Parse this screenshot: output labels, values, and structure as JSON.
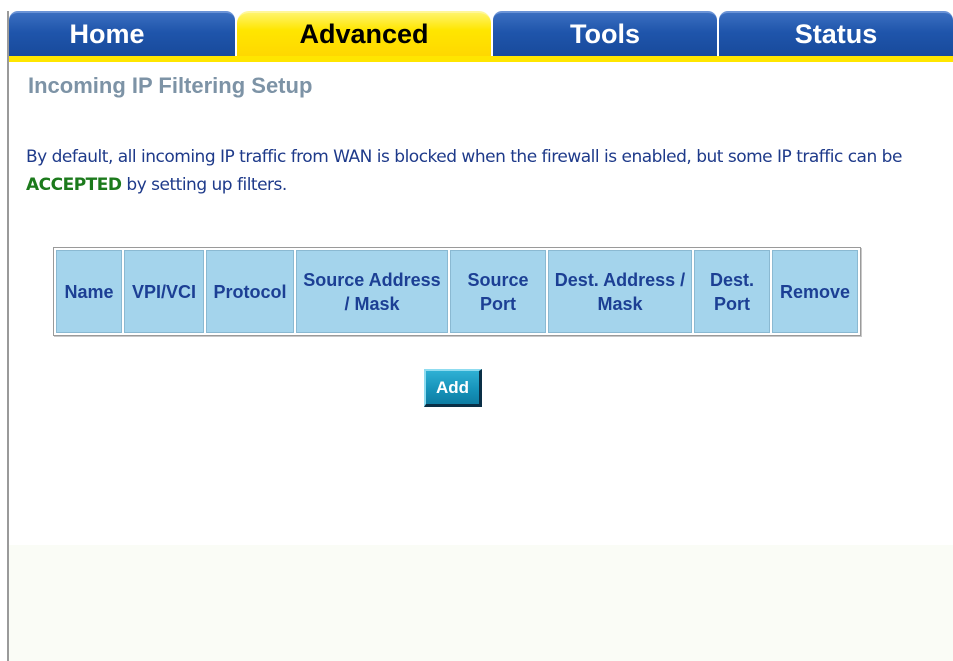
{
  "nav": {
    "tabs": [
      {
        "label": "Home",
        "active": false
      },
      {
        "label": "Advanced",
        "active": true
      },
      {
        "label": "Tools",
        "active": false
      },
      {
        "label": "Status",
        "active": false
      }
    ]
  },
  "page": {
    "title": "Incoming IP Filtering Setup",
    "description": {
      "before": "By default, all incoming IP traffic from WAN is blocked when the firewall is enabled, but some IP traffic can be ",
      "accent": "ACCEPTED",
      "after": " by setting up filters."
    }
  },
  "table": {
    "columns": {
      "name": "Name",
      "vpi_vci": "VPI/VCI",
      "protocol": "Protocol",
      "source_address_mask": "Source Address / Mask",
      "source_port": "Source Port",
      "dest_address_mask": "Dest. Address / Mask",
      "dest_port": "Dest. Port",
      "remove": "Remove"
    },
    "rows": []
  },
  "actions": {
    "add_label": "Add"
  },
  "colors": {
    "tab_blue": "#1f55ab",
    "tab_active": "#ffe600",
    "title_gray": "#7d93a6",
    "text_blue": "#1e3a8a",
    "accent_green": "#1c7a1c",
    "header_cell": "#a4d4ec",
    "button_teal": "#1591b8"
  }
}
